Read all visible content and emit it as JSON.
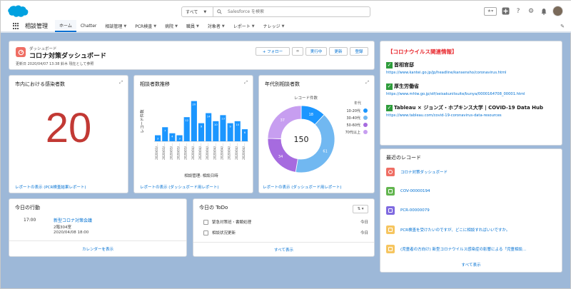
{
  "search": {
    "scope": "すべて",
    "placeholder": "Salesforce を検索"
  },
  "app": {
    "name": "相談管理"
  },
  "nav": {
    "items": [
      {
        "label": "ホーム",
        "dropdown": false,
        "active": true
      },
      {
        "label": "Chatter",
        "dropdown": false
      },
      {
        "label": "相談管理",
        "dropdown": true
      },
      {
        "label": "PCR検査",
        "dropdown": true
      },
      {
        "label": "病院",
        "dropdown": true
      },
      {
        "label": "職員",
        "dropdown": true
      },
      {
        "label": "対象者",
        "dropdown": true
      },
      {
        "label": "レポート",
        "dropdown": true
      },
      {
        "label": "ナレッジ",
        "dropdown": true
      }
    ]
  },
  "dashboard": {
    "type_label": "ダッシュボード",
    "title": "コロナ対策ダッシュボード",
    "meta": "更新日 2020/04/07 13:38 鈴木 現在として参照",
    "follow_label": "+ フォロー",
    "running_label": "実行中",
    "refresh_label": "更新",
    "subscribe_label": "登録"
  },
  "metric": {
    "title": "市内における感染者数",
    "value": "20",
    "footer": "レポートの表示 (PCR検査結果レポート)"
  },
  "bar": {
    "title": "相談者数推移",
    "ylabel": "レコード件数",
    "xlabel": "相談管理: 相談日時",
    "footer": "レポートの表示 (ダッシュボード用レポート)"
  },
  "donut": {
    "title": "年代別相談者数",
    "subtitle": "レコード件数",
    "legend_title": "年代",
    "center": "150",
    "footer": "レポートの表示 (ダッシュボード用レポート)"
  },
  "chart_data": [
    {
      "type": "bar",
      "title": "相談者数推移",
      "xlabel": "相談管理: 相談日時",
      "ylabel": "レコード件数",
      "categories": [
        "2020/03/...",
        "2020/03/...",
        "2020/03/...",
        "2020/03/...",
        "2020/03/...",
        "2020/04/...",
        "2020/04/...",
        "2020/04/...",
        "2020/04/...",
        "2020/04/...",
        "2020/04/...",
        "2020/04/...",
        "2020/04/..."
      ],
      "values": [
        3,
        7,
        4,
        3,
        12,
        20,
        9,
        14,
        10,
        13,
        9,
        10,
        6
      ],
      "ylim": [
        0,
        22
      ]
    },
    {
      "type": "pie",
      "title": "年代別相談者数",
      "center_value": 150,
      "slices": [
        {
          "label": "10-20代",
          "value": 18,
          "color": "#1b96ff"
        },
        {
          "label": "30-40代",
          "value": 61,
          "color": "#71b8f1"
        },
        {
          "label": "50-60代",
          "value": 34,
          "color": "#a66bdf"
        },
        {
          "label": "70代以上",
          "value": 37,
          "color": "#c79ef0"
        }
      ]
    }
  ],
  "info": {
    "title": "【コロナウイルス関連情報】",
    "items": [
      {
        "heading": "首相官邸",
        "url": "https://www.kantei.go.jp/jp/headline/kansensho/coronavirus.html"
      },
      {
        "heading": "厚生労働省",
        "url": "https://www.mhlw.go.jp/stf/seisakunitsuite/bunya/0000164708_00001.html"
      },
      {
        "heading": "Tableau × ジョンズ・ホプキンス大学 | COVID-19 Data Hub",
        "url": "https://www.tableau.com/covid-19-coronavirus-data-resources"
      }
    ]
  },
  "recent": {
    "title": "最近のレコード",
    "items": [
      {
        "label": "コロナ対策ダッシュボード",
        "icon": "dashboard-icon",
        "color": "#ef6e64"
      },
      {
        "label": "COV-00000194",
        "icon": "record-icon",
        "color": "#62b54e"
      },
      {
        "label": "PCR-00000079",
        "icon": "monitor-icon",
        "color": "#7f6ae0"
      },
      {
        "label": "PCR検査を受けたいのですが、どこに相談すればいいですか。",
        "icon": "knowledge-icon",
        "color": "#f6c55f"
      },
      {
        "label": "(児童者の方向け) 新型コロナウイルス感染症の影響による「児童相談...",
        "icon": "knowledge-icon",
        "color": "#f6c55f"
      }
    ],
    "view_all": "すべて表示"
  },
  "today": {
    "title": "今日の行動",
    "time": "17:00",
    "event": "新型コロナ対策会議",
    "room": "2階304室",
    "range": "2020/04/08 18:00",
    "calendar_link": "カレンダーを表示"
  },
  "todo": {
    "title": "今日の ToDo",
    "items": [
      {
        "label": "緊急対策班・書類処理",
        "date": "今日"
      },
      {
        "label": "相談状況更新",
        "date": "今日"
      }
    ],
    "view_all": "すべて表示"
  }
}
